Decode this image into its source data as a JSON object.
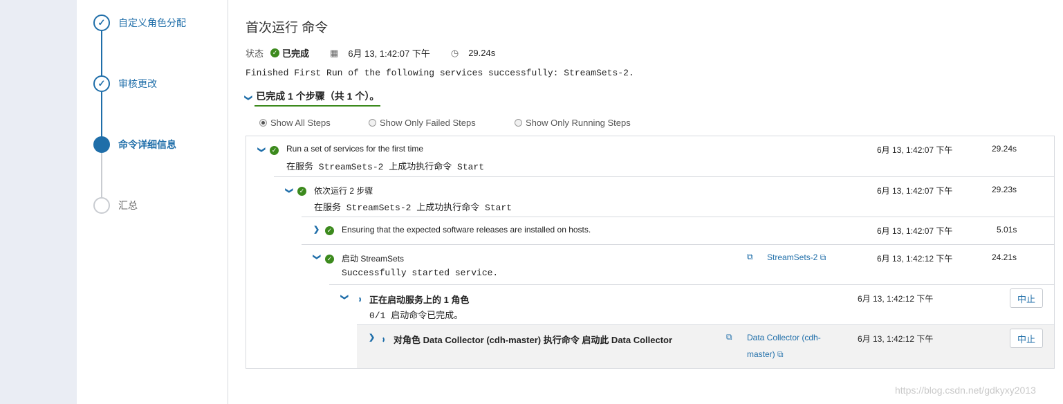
{
  "wizard": {
    "steps": [
      {
        "label": "自定义角色分配",
        "state": "done"
      },
      {
        "label": "审核更改",
        "state": "done"
      },
      {
        "label": "命令详细信息",
        "state": "current"
      },
      {
        "label": "汇总",
        "state": "pending"
      }
    ]
  },
  "header": {
    "title": "首次运行 命令",
    "status_label": "状态",
    "status_value": "已完成",
    "timestamp": "6月 13, 1:42:07 下午",
    "duration": "29.24s",
    "finished_message": "Finished First Run of the following services successfully: StreamSets-2.",
    "summary": "已完成 1 个步骤（共 1 个）。"
  },
  "filters": [
    {
      "label": "Show All Steps",
      "selected": true
    },
    {
      "label": "Show Only Failed Steps",
      "selected": false
    },
    {
      "label": "Show Only Running Steps",
      "selected": false
    }
  ],
  "steps": {
    "r1": {
      "title": "Run a set of services for the first time",
      "detail": "在服务 StreamSets-2 上成功执行命令 Start",
      "time": "6月 13, 1:42:07 下午",
      "duration": "29.24s"
    },
    "r2": {
      "title": "依次运行 2 步骤",
      "detail": "在服务 StreamSets-2 上成功执行命令 Start",
      "time": "6月 13, 1:42:07 下午",
      "duration": "29.23s"
    },
    "r3": {
      "title": "Ensuring that the expected software releases are installed on hosts.",
      "time": "6月 13, 1:42:07 下午",
      "duration": "5.01s"
    },
    "r4": {
      "title": "启动 StreamSets",
      "detail": "Successfully started service.",
      "link": "StreamSets-2",
      "time": "6月 13, 1:42:12 下午",
      "duration": "24.21s"
    },
    "r5": {
      "title": "正在启动服务上的 1 角色",
      "detail": "0/1 启动命令已完成。",
      "time": "6月 13, 1:42:12 下午",
      "action": "中止"
    },
    "r6": {
      "title": "对角色 Data Collector (cdh-master) 执行命令 启动此 Data Collector",
      "link_line1": "Data Collector (cdh-",
      "link_line2": "master)",
      "time": "6月 13, 1:42:12 下午",
      "action": "中止"
    }
  },
  "watermark": "https://blog.csdn.net/gdkyxy2013"
}
